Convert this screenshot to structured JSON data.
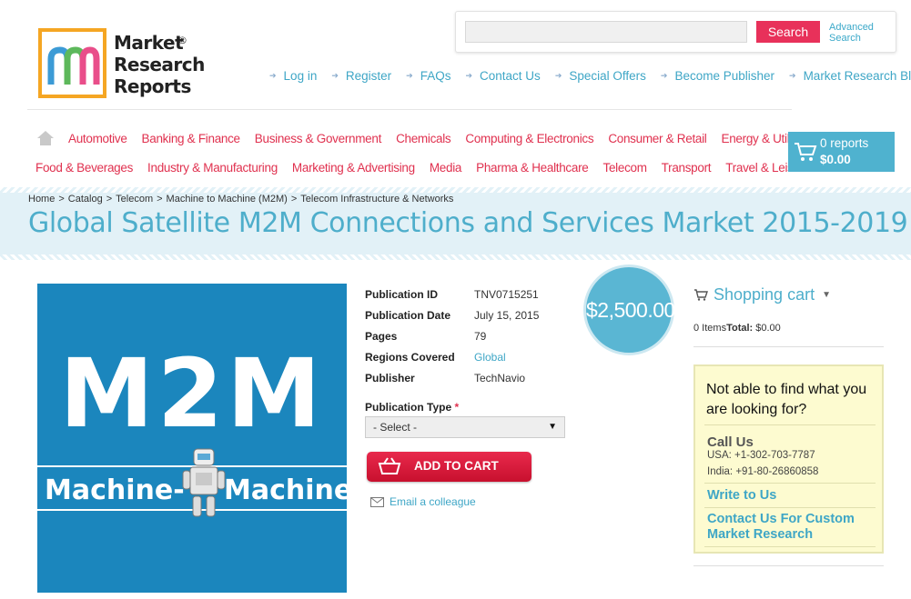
{
  "logo": {
    "line1": "Market",
    "line2": "Research",
    "line3": "Reports",
    "reg": "®"
  },
  "search": {
    "placeholder": "",
    "button": "Search",
    "advanced_line1": "Advanced",
    "advanced_line2": "Search"
  },
  "top_links": [
    "Log in",
    "Register",
    "FAQs",
    "Contact Us",
    "Special Offers",
    "Become Publisher",
    "Market Research Blog"
  ],
  "categories_row1": [
    "Automotive",
    "Banking & Finance",
    "Business & Government",
    "Chemicals",
    "Computing & Electronics",
    "Consumer & Retail",
    "Energy & Utilities"
  ],
  "categories_row2": [
    "Food & Beverages",
    "Industry & Manufacturing",
    "Marketing & Advertising",
    "Media",
    "Pharma & Healthcare",
    "Telecom",
    "Transport",
    "Travel & Leisure"
  ],
  "cart": {
    "reports": "0 reports",
    "total": "$0.00"
  },
  "breadcrumb": [
    "Home",
    "Catalog",
    "Telecom",
    "Machine to Machine (M2M)",
    "Telecom Infrastructure & Networks"
  ],
  "title": "Global Satellite M2M Connections and Services Market 2015-2019",
  "product_image": {
    "big": "M2M",
    "left": "Machine-",
    "right": "Machine"
  },
  "details": {
    "pub_id_label": "Publication ID",
    "pub_id": "TNV0715251",
    "pub_date_label": "Publication Date",
    "pub_date": "July 15, 2015",
    "pages_label": "Pages",
    "pages": "79",
    "regions_label": "Regions Covered",
    "regions": "Global",
    "publisher_label": "Publisher",
    "publisher": "TechNavio"
  },
  "pub_type": {
    "label": "Publication Type",
    "required": "*",
    "selected": "- Select -"
  },
  "add_to_cart": "ADD TO CART",
  "email": "Email a colleague",
  "price": "$2,500.00",
  "shopping_cart": {
    "title": "Shopping cart",
    "items": "0 Items",
    "total_label": "Total:",
    "total": "$0.00"
  },
  "help": {
    "question": "Not able to find what you are looking for?",
    "call_us": "Call Us",
    "usa": "USA: +1-302-703-7787",
    "india": "India: +91-80-26860858",
    "write": "Write to Us",
    "custom": "Contact Us For Custom Market Research"
  },
  "colors": {
    "accent": "#4eaecb",
    "category": "#e0314f",
    "button": "#e8315a"
  }
}
